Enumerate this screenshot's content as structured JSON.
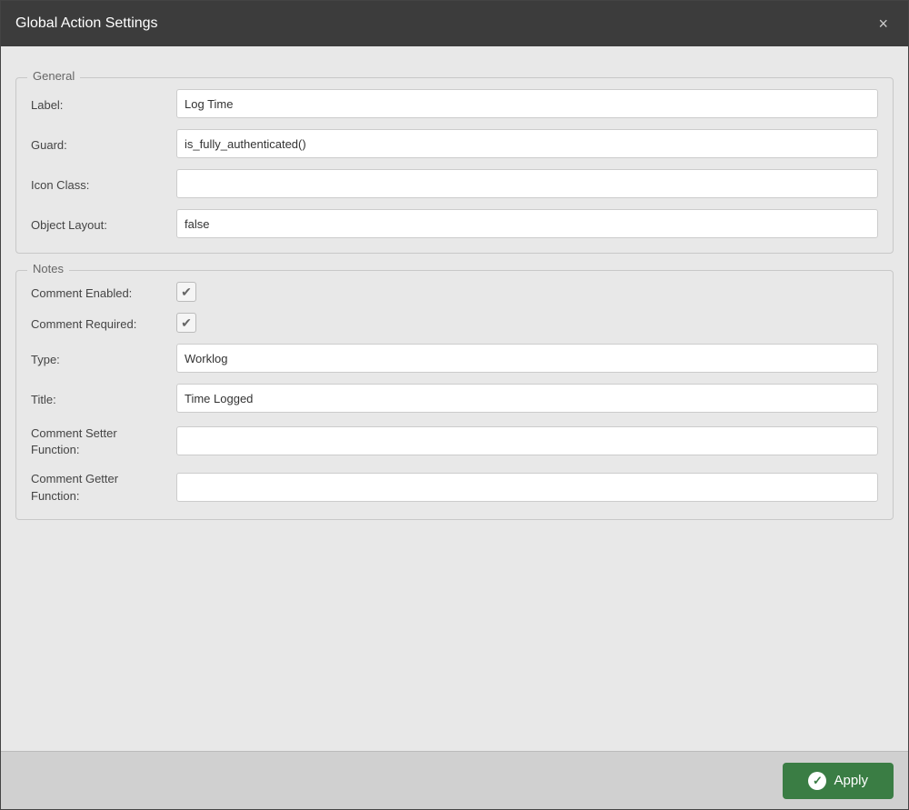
{
  "dialog": {
    "title": "Global Action Settings",
    "close_label": "×"
  },
  "general_section": {
    "legend": "General",
    "fields": [
      {
        "label": "Label:",
        "value": "Log Time",
        "id": "label-input"
      },
      {
        "label": "Guard:",
        "value": "is_fully_authenticated()",
        "id": "guard-input"
      },
      {
        "label": "Icon Class:",
        "value": "",
        "id": "icon-class-input"
      },
      {
        "label": "Object Layout:",
        "value": "false",
        "id": "object-layout-input"
      }
    ]
  },
  "notes_section": {
    "legend": "Notes",
    "checkboxes": [
      {
        "label": "Comment Enabled:",
        "checked": true,
        "id": "comment-enabled"
      },
      {
        "label": "Comment Required:",
        "checked": true,
        "id": "comment-required"
      }
    ],
    "fields": [
      {
        "label": "Type:",
        "value": "Worklog",
        "id": "type-input"
      },
      {
        "label": "Title:",
        "value": "Time Logged",
        "id": "title-input"
      },
      {
        "label": "Comment Setter\nFunction:",
        "value": "",
        "id": "setter-input"
      },
      {
        "label": "Comment Getter\nFunction:",
        "value": "",
        "id": "getter-input"
      }
    ]
  },
  "footer": {
    "apply_label": "Apply"
  }
}
